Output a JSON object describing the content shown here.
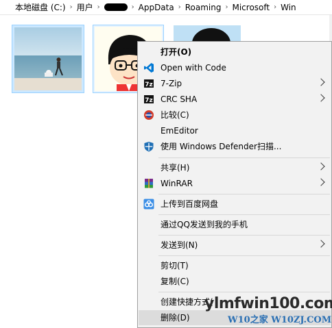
{
  "breadcrumb": {
    "items": [
      "本地磁盘 (C:)",
      "用户",
      "",
      "AppData",
      "Roaming",
      "Microsoft",
      "Win"
    ]
  },
  "context_menu": {
    "items": [
      {
        "label": "打开(O)",
        "icon": "none",
        "submenu": false
      },
      {
        "label": "Open with Code",
        "icon": "vscode-icon",
        "submenu": false
      },
      {
        "label": "7-Zip",
        "icon": "7zip-icon",
        "submenu": true
      },
      {
        "label": "CRC SHA",
        "icon": "7zip-icon",
        "submenu": true
      },
      {
        "label": "比较(C)",
        "icon": "compare-icon",
        "submenu": false
      },
      {
        "label": "EmEditor",
        "icon": "none",
        "submenu": false
      },
      {
        "label": "使用 Windows Defender扫描...",
        "icon": "defender-shield-icon",
        "submenu": false
      },
      {
        "label": "共享(H)",
        "icon": "none",
        "submenu": true
      },
      {
        "label": "WinRAR",
        "icon": "winrar-icon",
        "submenu": true
      },
      {
        "label": "上传到百度网盘",
        "icon": "baidu-netdisk-icon",
        "submenu": false
      },
      {
        "label": "通过QQ发送到我的手机",
        "icon": "none",
        "submenu": false
      },
      {
        "label": "发送到(N)",
        "icon": "none",
        "submenu": true
      },
      {
        "label": "剪切(T)",
        "icon": "none",
        "submenu": false
      },
      {
        "label": "复制(C)",
        "icon": "none",
        "submenu": false
      },
      {
        "label": "创建快捷方式(",
        "icon": "none",
        "submenu": false
      },
      {
        "label": "删除(D)",
        "icon": "none",
        "submenu": false
      }
    ]
  },
  "watermark": {
    "main": "ylmfwin100.com",
    "sub": "W10之家 W10ZJ.COM"
  },
  "colors": {
    "selection": "#cce8ff",
    "menu_bg": "#f2f2f2",
    "vscode": "#0078d4",
    "defender": "#1f6fb5"
  }
}
